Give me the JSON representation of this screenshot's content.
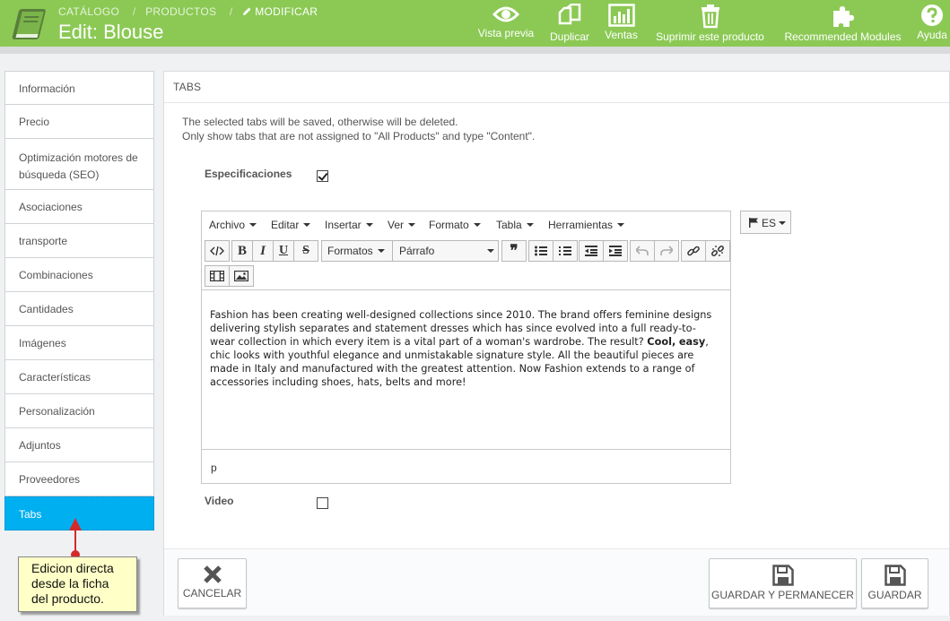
{
  "header": {
    "breadcrumb": [
      "CATÁLOGO",
      "/",
      "PRODUCTOS",
      "/"
    ],
    "breadcrumb_current": "MODIFICAR",
    "title": "Edit: Blouse",
    "toolbar": {
      "preview": "Vista previa",
      "duplicate": "Duplicar",
      "sales": "Ventas",
      "delete": "Suprimir este producto",
      "modules": "Recommended Modules",
      "help": "Ayuda"
    },
    "bg_color": "#8bc954"
  },
  "sidebar": {
    "items": [
      {
        "label": "Información"
      },
      {
        "label": "Precio"
      },
      {
        "label": "Optimización motores de búsqueda (SEO)"
      },
      {
        "label": "Asociaciones"
      },
      {
        "label": "transporte"
      },
      {
        "label": "Combinaciones"
      },
      {
        "label": "Cantidades"
      },
      {
        "label": "Imágenes"
      },
      {
        "label": "Características"
      },
      {
        "label": "Personalización"
      },
      {
        "label": "Adjuntos"
      },
      {
        "label": "Proveedores"
      },
      {
        "label": "Tabs"
      }
    ],
    "active_color": "#00aff0"
  },
  "tooltip": {
    "text_lines": [
      "Edicion directa",
      "desde la ficha",
      "del producto."
    ]
  },
  "panel": {
    "title": "TABS",
    "info_lines": [
      "The selected tabs will be saved, otherwise will be deleted.",
      "Only show tabs that are not assigned to \"All Products\" and type \"Content\"."
    ],
    "field_specs": {
      "label": "Especificaciones",
      "checked": true
    },
    "field_video": {
      "label": "Video",
      "checked": false
    },
    "lang": "ES"
  },
  "editor": {
    "menu": {
      "file": "Archivo",
      "edit": "Editar",
      "insert": "Insertar",
      "view": "Ver",
      "format": "Formato",
      "table": "Tabla",
      "tools": "Herramientas"
    },
    "formats_label": "Formatos",
    "block_label": "Párrafo",
    "content": {
      "part1": "Fashion has been creating well-designed collections since 2010. The brand offers feminine designs delivering stylish separates and statement dresses which has since evolved into a full ready-to-wear collection in which every item is a vital part of a woman's wardrobe. The result? ",
      "bold1": "Cool,",
      "space": " ",
      "bold2": "easy",
      "part2": ", chic looks with youthful elegance and unmistakable signature style. All the beautiful pieces are made in Italy and manufactured with the greatest attention. Now Fashion extends to a range of accessories including shoes, hats, belts and more!"
    },
    "status_path": "p"
  },
  "footer": {
    "cancel": "CANCELAR",
    "save_stay": "GUARDAR Y PERMANECER",
    "save": "GUARDAR"
  }
}
